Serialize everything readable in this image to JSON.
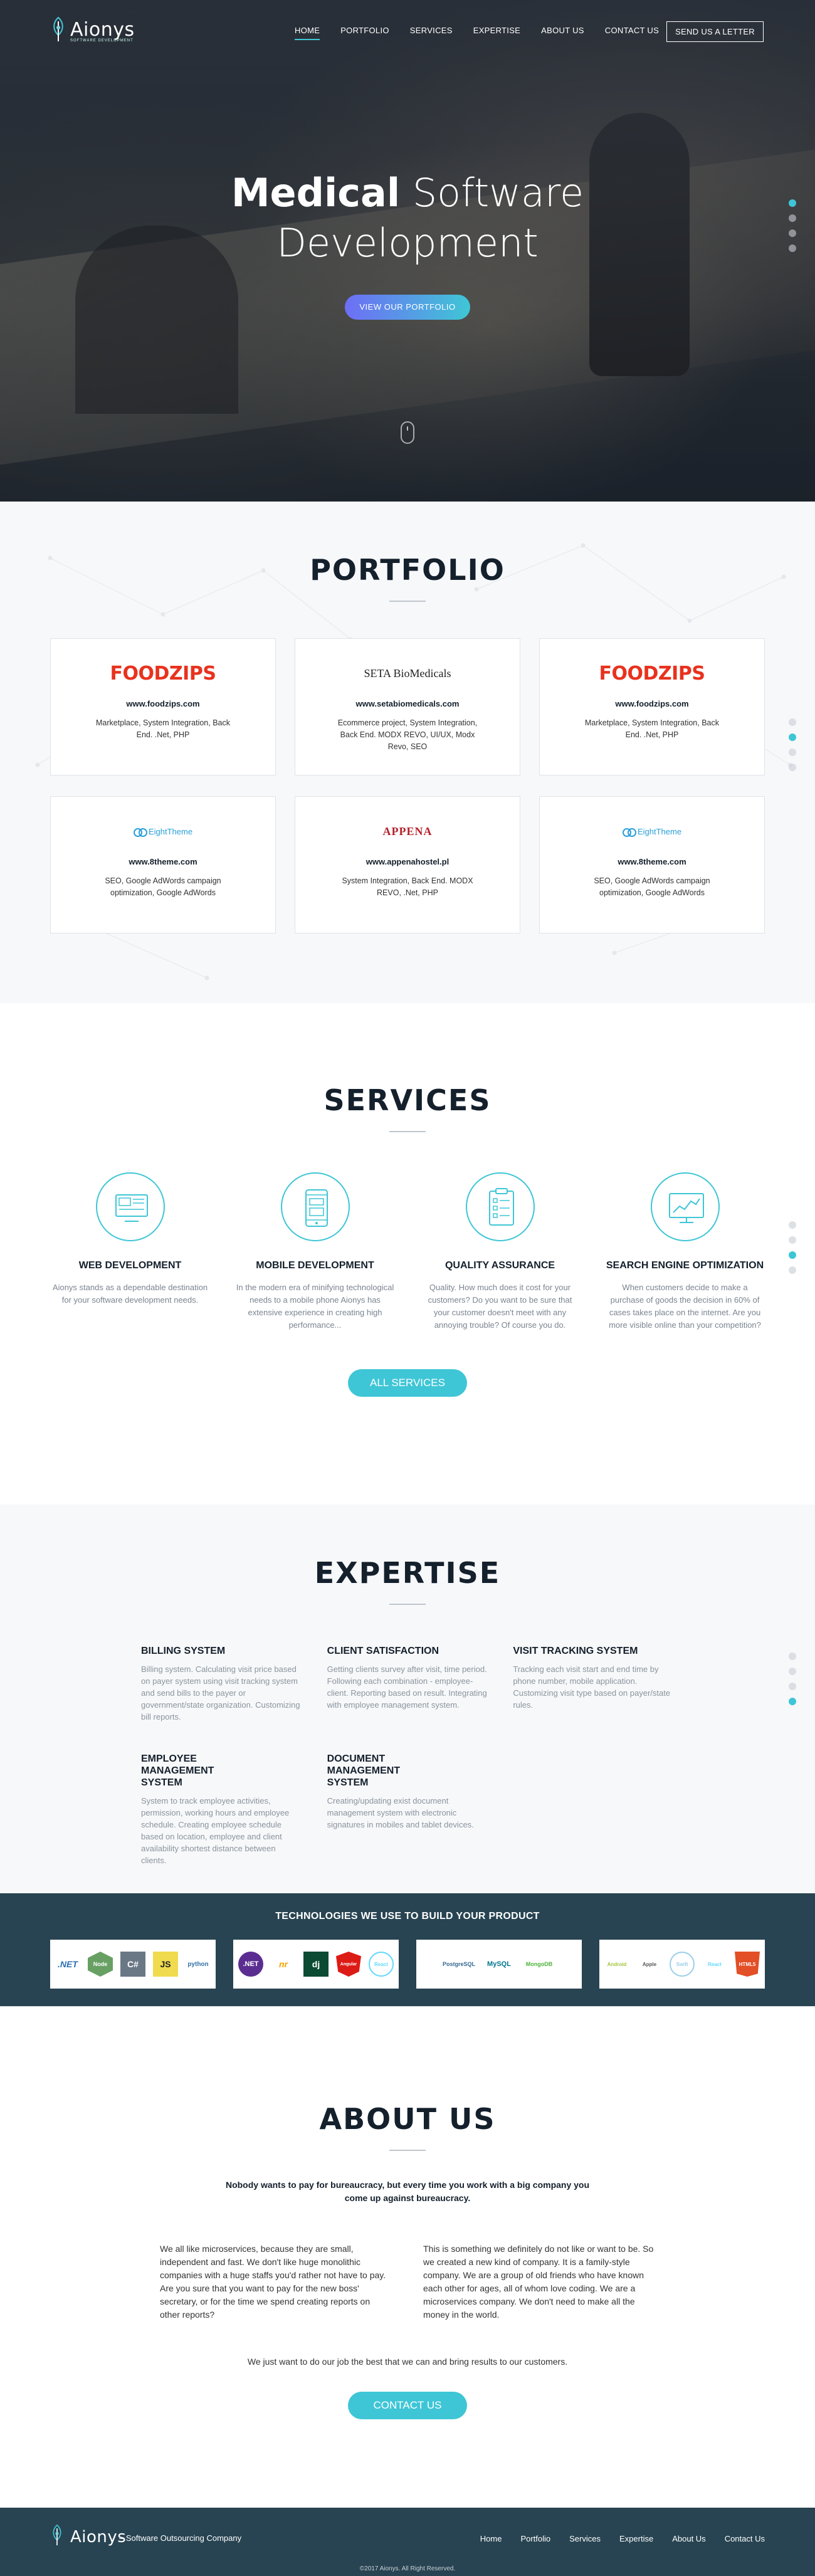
{
  "brand": {
    "name": "Aionys",
    "tagline": "SOFTWARE DEVELOPMENT",
    "accent": "#3fc6d6",
    "dark": "#284452"
  },
  "nav": {
    "items": [
      "Home",
      "Portfolio",
      "Services",
      "Expertise",
      "About us",
      "Contact us"
    ],
    "active": "Home",
    "cta": "Send us a letter"
  },
  "hero": {
    "title_bold": "Medical",
    "title_rest": "Software",
    "title_line2": "Development",
    "button": "View our portfolio"
  },
  "portfolio": {
    "title": "Portfolio",
    "cards": [
      {
        "logo": "FOODZIPS",
        "site": "www.foodzips.com",
        "desc": "Marketplace, System Integration, Back End. .Net, PHP"
      },
      {
        "logo": "SETA BioMedicals",
        "site": "www.setabiomedicals.com",
        "desc": "Ecommerce project, System Integration, Back End. MODX REVO, UI/UX, Modx Revo, SEO"
      },
      {
        "logo": "FOODZIPS",
        "site": "www.foodzips.com",
        "desc": "Marketplace, System Integration, Back End. .Net, PHP"
      },
      {
        "logo": "EightTheme",
        "site": "www.8theme.com",
        "desc": "SEO, Google AdWords campaign optimization, Google AdWords"
      },
      {
        "logo": "APPENA",
        "site": "www.appenahostel.pl",
        "desc": "System Integration, Back End. MODX REVO, .Net, PHP"
      },
      {
        "logo": "EightTheme",
        "site": "www.8theme.com",
        "desc": "SEO, Google AdWords campaign optimization, Google AdWords"
      }
    ]
  },
  "services": {
    "title": "Services",
    "items": [
      {
        "icon": "monitor-icon",
        "name": "Web Development",
        "desc": "Aionys stands as a dependable destination for your software development needs."
      },
      {
        "icon": "mobile-icon",
        "name": "Mobile Development",
        "desc": "In the modern era of minifying technological needs to a mobile phone Aionys has extensive experience in creating high performance..."
      },
      {
        "icon": "clipboard-icon",
        "name": "Quality Assurance",
        "desc": "Quality. How much does it cost for your customers? Do you want to be sure that your customer doesn't meet with any annoying trouble? Of course you do."
      },
      {
        "icon": "chart-icon",
        "name": "Search Engine Optimization",
        "desc": "When customers decide to make a purchase of goods the decision in 60% of cases takes place on the internet. Are you more visible online than your competition?"
      }
    ],
    "button": "All services"
  },
  "expertise": {
    "title": "Expertise",
    "items": [
      {
        "name": "Billing System",
        "desc": "Billing system. Calculating visit price based on payer system using visit tracking system and send bills to the payer or government/state organization. Customizing bill reports."
      },
      {
        "name": "Client Satisfaction",
        "desc": "Getting clients survey after visit, time period. Following each combination - employee-client. Reporting based on result. Integrating with employee management system."
      },
      {
        "name": "Visit Tracking System",
        "desc": "Tracking each visit start and end time by phone number, mobile application. Customizing visit type based on payer/state rules."
      },
      {
        "name": "Employee Management System",
        "desc": "System to track employee activities, permission, working hours and employee schedule. Creating employee schedule based on location, employee and client availability shortest distance between clients."
      },
      {
        "name": "Document Management System",
        "desc": "Creating/updating exist document management system with electronic signatures in mobiles and tablet devices."
      }
    ]
  },
  "technologies": {
    "title": "Technologies we use to build your product",
    "groups": [
      [
        ".NET",
        "Node",
        "C#",
        "JS",
        "python"
      ],
      [
        ".NET",
        "nr",
        "dj",
        "Angular",
        "React"
      ],
      [
        "PostgreSQL",
        "MySQL",
        "MongoDB"
      ],
      [
        "Android",
        "Apple",
        "Swift",
        "React",
        "HTML5"
      ]
    ]
  },
  "about": {
    "title": "About us",
    "lead": "Nobody wants to pay for bureaucracy, but every time you work with a big company you come up against bureaucracy.",
    "col1": "We all like microservices, because they are small, independent and fast. We don't like huge monolithic companies with a huge staffs you'd rather not have to pay. Are you sure that you want to pay for the new boss' secretary, or for the time we spend creating reports on other reports?",
    "col2": "This is something we definitely do not like or want to be. So we created a new kind of company. It is a family-style company. We are a group of old friends who have known each other for ages, all of whom love coding. We are a microservices company. We don't need to make all the money in the world.",
    "end": "We just want to do our job the best that we can and bring results to our customers.",
    "button": "Contact us"
  },
  "footer": {
    "tagline": "– Software Outsourcing Company",
    "links": [
      "Home",
      "Portfolio",
      "Services",
      "Expertise",
      "About Us",
      "Contact Us"
    ],
    "copyright": "©2017 Aionys. All Right Reserved."
  }
}
